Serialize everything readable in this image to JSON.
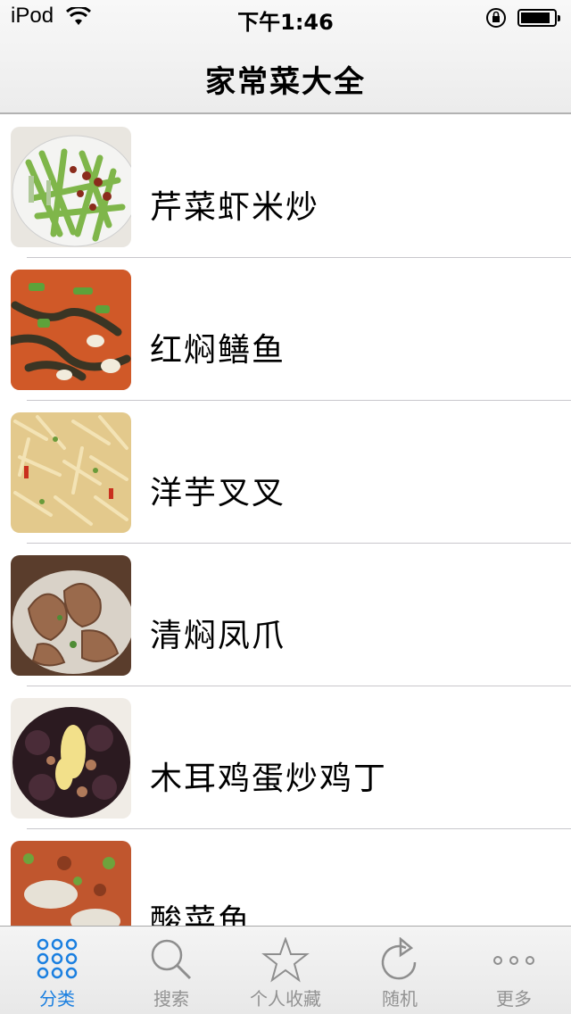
{
  "status_bar": {
    "carrier": "iPod",
    "time": "下午1:46"
  },
  "nav": {
    "title": "家常菜大全"
  },
  "dishes": [
    {
      "name": "芹菜虾米炒",
      "thumb_icon": "celery-shrimp-photo"
    },
    {
      "name": "红焖鳝鱼",
      "thumb_icon": "braised-eel-photo"
    },
    {
      "name": "洋芋叉叉",
      "thumb_icon": "potato-shreds-photo"
    },
    {
      "name": "清焖凤爪",
      "thumb_icon": "chicken-feet-photo"
    },
    {
      "name": "木耳鸡蛋炒鸡丁",
      "thumb_icon": "wood-ear-egg-chicken-photo"
    },
    {
      "name": "酸菜鱼",
      "thumb_icon": "pickled-fish-photo"
    }
  ],
  "tabs": [
    {
      "label": "分类",
      "icon": "grid-dots-icon",
      "active": true
    },
    {
      "label": "搜索",
      "icon": "search-icon",
      "active": false
    },
    {
      "label": "个人收藏",
      "icon": "star-icon",
      "active": false
    },
    {
      "label": "随机",
      "icon": "refresh-icon",
      "active": false
    },
    {
      "label": "更多",
      "icon": "more-dots-icon",
      "active": false
    }
  ],
  "colors": {
    "tab_active": "#1a7fe0",
    "tab_inactive": "#929292",
    "separator": "#c8c7cc"
  }
}
